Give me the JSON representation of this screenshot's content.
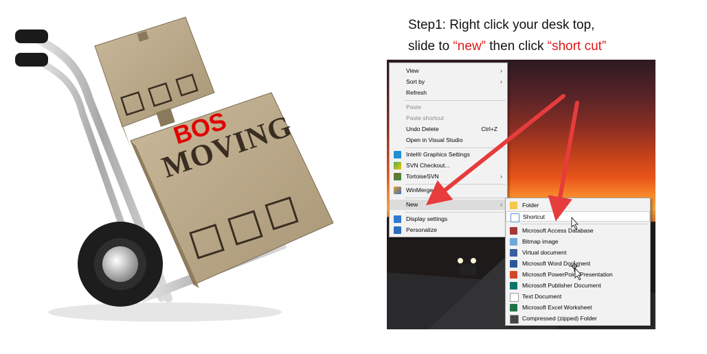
{
  "illustration": {
    "bos_text": "BOS",
    "moving_text": "MOVING"
  },
  "instructions": {
    "line1": "Step1: Right click your desk top,",
    "line2_prefix": "slide to ",
    "line2_new": "“new”",
    "line2_middle": " then click ",
    "line2_shortcut": "“short cut”"
  },
  "context_menu": {
    "items": [
      {
        "label": "View",
        "submenu": true
      },
      {
        "label": "Sort by",
        "submenu": true
      },
      {
        "label": "Refresh"
      },
      {
        "label": "Paste",
        "disabled": true
      },
      {
        "label": "Paste shortcut",
        "disabled": true
      },
      {
        "label": "Undo Delete",
        "shortcut": "Ctrl+Z"
      },
      {
        "label": "Open in Visual Studio"
      },
      {
        "label": "Intel® Graphics Settings",
        "icon": "intel-graphics-icon"
      },
      {
        "label": "SVN Checkout...",
        "icon": "svn-checkout-icon"
      },
      {
        "label": "TortoiseSVN",
        "icon": "tortoisesvn-icon",
        "submenu": true
      },
      {
        "label": "WinMerge",
        "icon": "winmerge-icon"
      },
      {
        "label": "New",
        "submenu": true,
        "highlighted": true
      },
      {
        "label": "Display settings",
        "icon": "display-settings-icon"
      },
      {
        "label": "Personalize",
        "icon": "personalize-icon"
      }
    ]
  },
  "new_submenu": {
    "items": [
      {
        "label": "Folder",
        "icon": "folder-icon"
      },
      {
        "label": "Shortcut",
        "icon": "shortcut-icon",
        "highlighted": true
      },
      {
        "label": "Microsoft Access Database",
        "icon": "access-icon"
      },
      {
        "label": "Bitmap image",
        "icon": "bitmap-icon"
      },
      {
        "label": "Virtual document",
        "icon": "virtual-document-icon"
      },
      {
        "label": "Microsoft Word Document",
        "icon": "word-icon"
      },
      {
        "label": "Microsoft PowerPoint Presentation",
        "icon": "powerpoint-icon"
      },
      {
        "label": "Microsoft Publisher Document",
        "icon": "publisher-icon"
      },
      {
        "label": "Text Document",
        "icon": "text-document-icon"
      },
      {
        "label": "Microsoft Excel Worksheet",
        "icon": "excel-icon"
      },
      {
        "label": "Compressed (zipped) Folder",
        "icon": "zip-folder-icon"
      }
    ]
  },
  "colors": {
    "highlight_red": "#e01818",
    "arrow_red": "#e63c3c",
    "menu_bg": "#f2f2f2",
    "menu_highlight": "#dcdcdc"
  }
}
